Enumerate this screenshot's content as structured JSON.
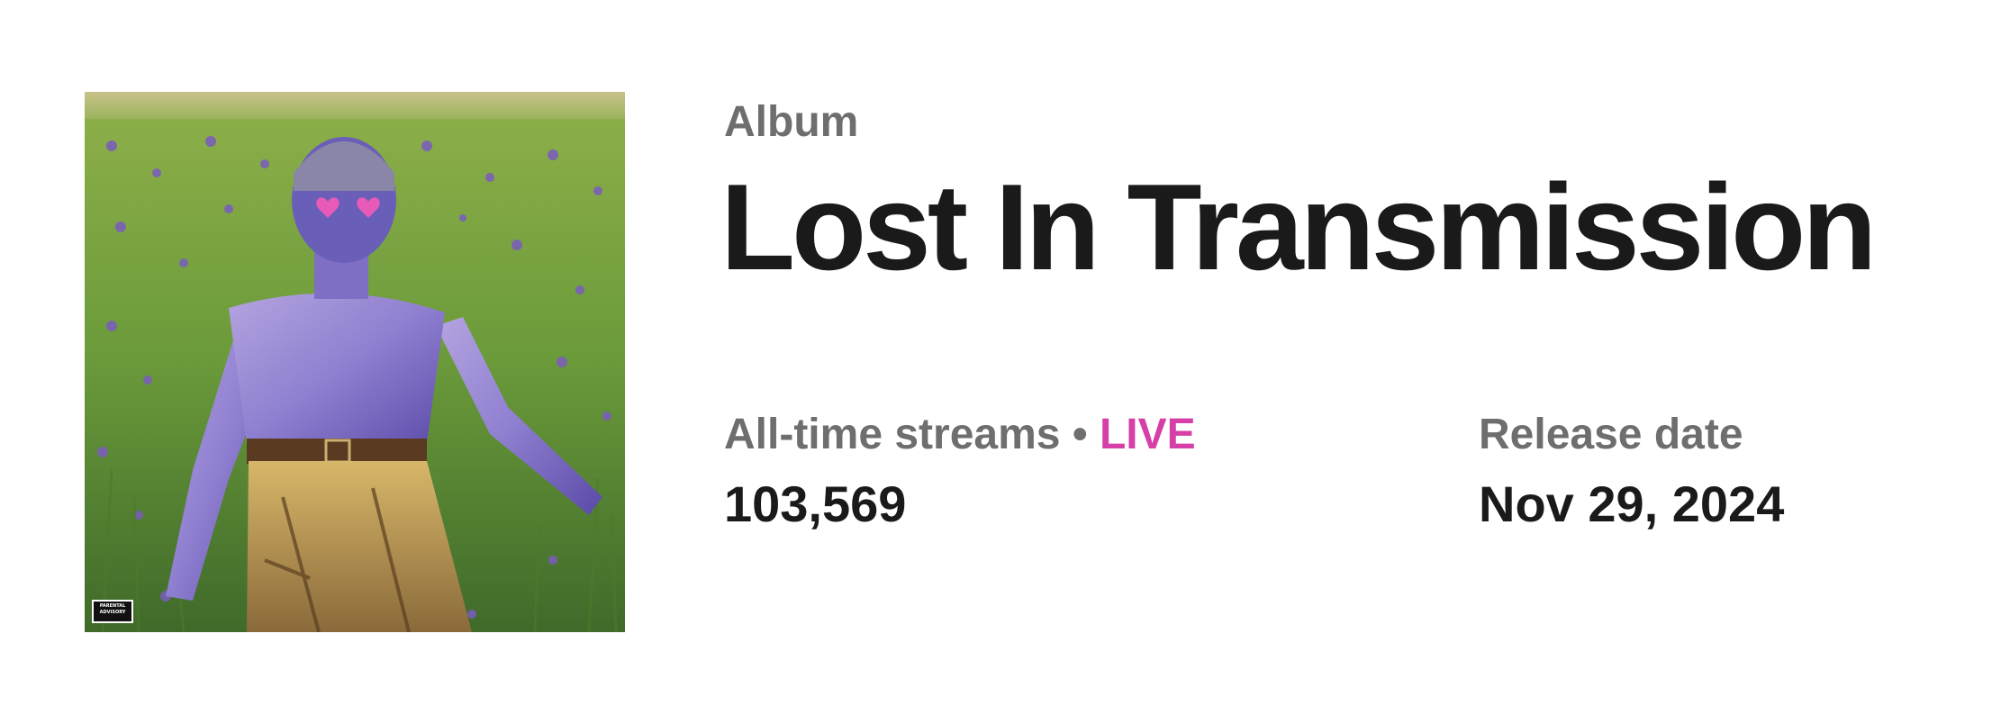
{
  "album": {
    "type_label": "Album",
    "title": "Lost In Transmission",
    "cover_art_icon": "album-cover-art",
    "advisory_text": "PARENTAL ADVISORY"
  },
  "stats": {
    "streams_label": "All-time streams",
    "separator": "•",
    "live_label": "LIVE",
    "streams_value": "103,569",
    "release_label": "Release date",
    "release_value": "Nov 29, 2024"
  },
  "colors": {
    "live_accent": "#d63fa8",
    "label_gray": "#6e6e6e",
    "title_dark": "#1a1a1a"
  }
}
